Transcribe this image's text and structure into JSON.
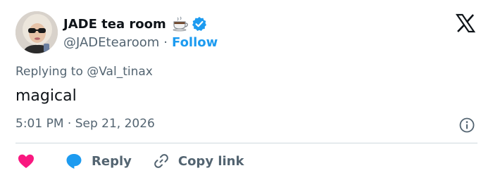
{
  "author": {
    "display_name": "JADE tea room",
    "handle": "@JADEtearoom",
    "separator": "·",
    "follow_label": "Follow",
    "emoji": "teacup-icon",
    "verified": true,
    "verified_color": "#1d9bf0"
  },
  "platform_logo": "x-logo-icon",
  "reply_context": "Replying to @Val_tinax",
  "tweet_text": "magical",
  "timestamp": "5:01 PM · Sep 21, 2026",
  "info_icon": "info-icon",
  "actions": {
    "like_icon": "heart-icon",
    "like_color": "#f91880",
    "reply_label": "Reply",
    "reply_icon": "speech-bubble-icon",
    "reply_color": "#1d9bf0",
    "copy_label": "Copy link",
    "copy_icon": "link-icon"
  },
  "colors": {
    "text_primary": "#0f1419",
    "text_secondary": "#536471",
    "accent": "#1d9bf0",
    "divider": "#cfd9de"
  }
}
